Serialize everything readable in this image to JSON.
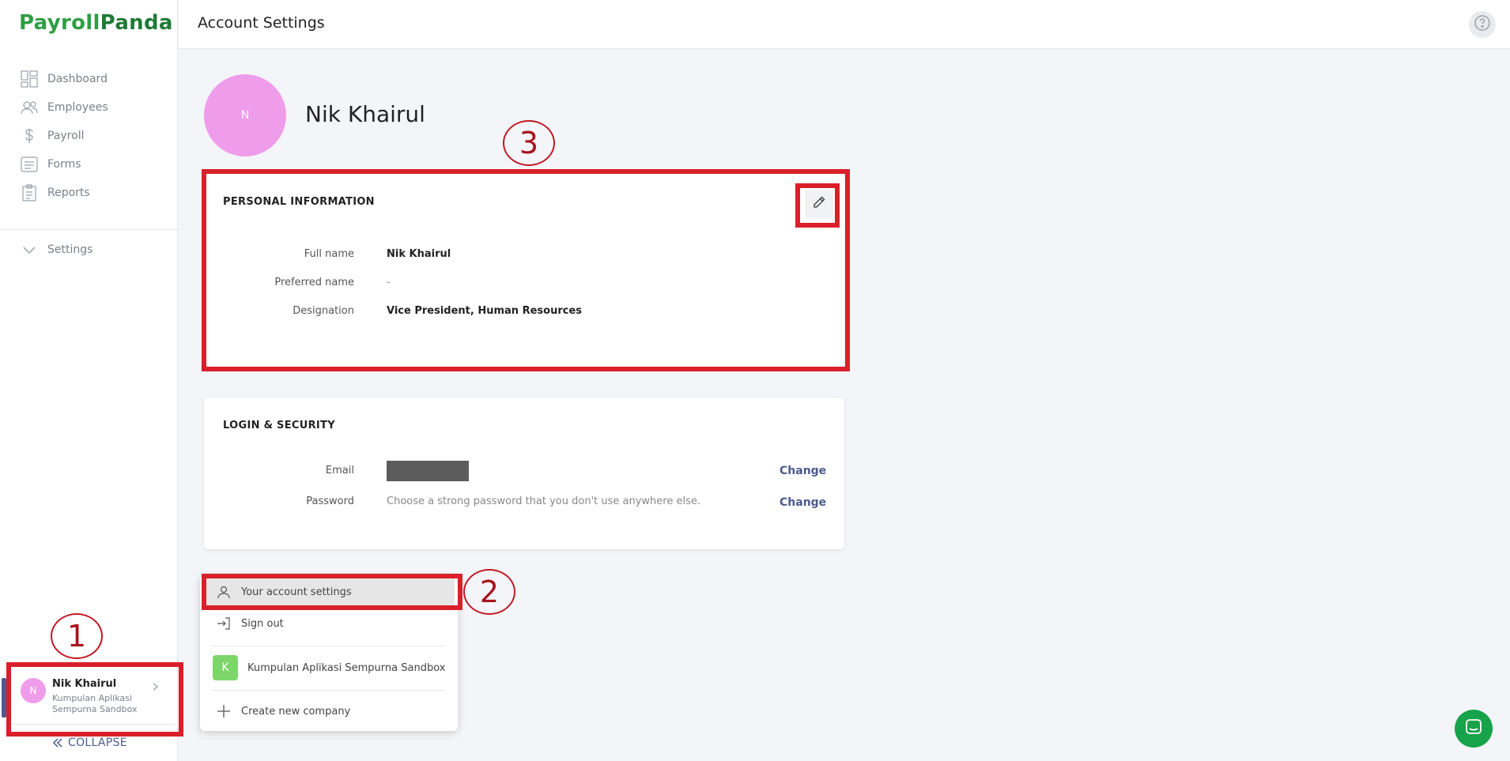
{
  "app": {
    "logo_part1": "Payroll",
    "logo_part2": "Panda"
  },
  "sidebar": {
    "items": [
      {
        "label": "Dashboard",
        "icon": "dashboard-icon"
      },
      {
        "label": "Employees",
        "icon": "employees-icon"
      },
      {
        "label": "Payroll",
        "icon": "dollar-icon"
      },
      {
        "label": "Forms",
        "icon": "forms-icon"
      },
      {
        "label": "Reports",
        "icon": "reports-icon"
      }
    ],
    "settings_label": "Settings",
    "user": {
      "initial": "N",
      "name": "Nik Khairul",
      "company": "Kumpulan Aplikasi Sempurna Sandbox"
    },
    "collapse_label": "COLLAPSE"
  },
  "header": {
    "title": "Account Settings"
  },
  "profile": {
    "initial": "N",
    "name": "Nik Khairul"
  },
  "personal": {
    "title": "PERSONAL INFORMATION",
    "full_name_label": "Full name",
    "full_name": "Nik Khairul",
    "preferred_label": "Preferred name",
    "preferred": "-",
    "designation_label": "Designation",
    "designation": "Vice President, Human Resources"
  },
  "login": {
    "title": "LOGIN & SECURITY",
    "email_label": "Email",
    "password_label": "Password",
    "password_hint": "Choose a strong password that you don't use anywhere else.",
    "change_label": "Change"
  },
  "menu": {
    "account_settings": "Your account settings",
    "sign_out": "Sign out",
    "company_initial": "K",
    "company_name": "Kumpulan Aplikasi Sempurna Sandbox",
    "create_company": "Create new company"
  },
  "annotations": {
    "one": "1",
    "two": "2",
    "three": "3"
  },
  "colors": {
    "brand_green": "#2f9e44",
    "accent": "#4b5b8a",
    "highlight": "#d9202a",
    "avatar": "#ef9ceb"
  }
}
